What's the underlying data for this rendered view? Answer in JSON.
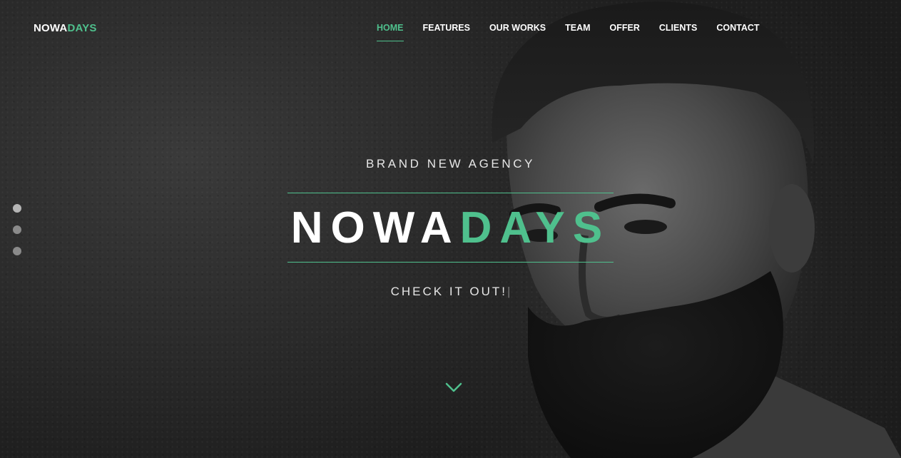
{
  "brand": {
    "part1": "NOWA",
    "part2": "DAYS"
  },
  "nav": {
    "items": [
      {
        "label": "HOME",
        "active": true
      },
      {
        "label": "FEATURES"
      },
      {
        "label": "OUR WORKS"
      },
      {
        "label": "TEAM"
      },
      {
        "label": "OFFER"
      },
      {
        "label": "CLIENTS"
      },
      {
        "label": "CONTACT"
      }
    ]
  },
  "hero": {
    "tagline": "BRAND NEW AGENCY",
    "title_part1": "NOWA",
    "title_part2": "DAYS",
    "cta": "CHECK IT OUT!",
    "cta_caret": "|",
    "scroll_icon": "chevron-down-icon",
    "slides": 3,
    "active_slide": 1
  },
  "colors": {
    "accent": "#4fc08d",
    "text": "#ffffff",
    "background": "#2a2a2a"
  }
}
